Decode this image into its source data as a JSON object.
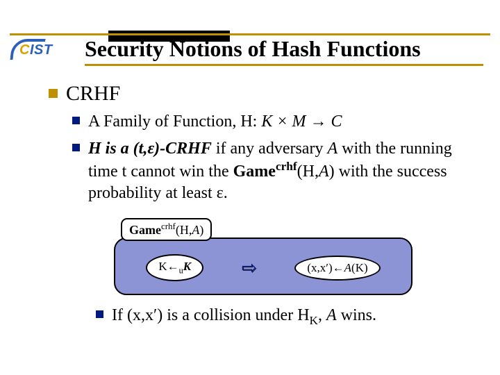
{
  "logo": {
    "left": "C",
    "rest": "IST"
  },
  "title": "Security Notions of Hash Functions",
  "lvl1": "CRHF",
  "b1_prefix": "A Family of Function, H: ",
  "b1_expr": "K × M → C",
  "b2": {
    "lead": "H is a (t,ε)-CRHF",
    "mid": " if any adversary ",
    "A": "A",
    "mid2": " with the running time t cannot win the ",
    "game": "Game",
    "crhf": "crhf",
    "hA": "(H,",
    "A2": "A",
    "close": ")",
    "tail": " with the success probability at least ε."
  },
  "game": {
    "label_game": "Game",
    "label_sup": "crhf",
    "label_args": "(H,",
    "label_A": "A",
    "label_close": ")",
    "step1_pre": "K←",
    "step1_sub": "u",
    "step1_post": "K",
    "step2_pre": "(x,x′)←",
    "step2_A": "A",
    "step2_post": "(K)"
  },
  "b3": {
    "pre": "If (x,x′) is a collision under H",
    "sub": "K",
    "mid": ", ",
    "A": "A",
    "post": " wins."
  }
}
